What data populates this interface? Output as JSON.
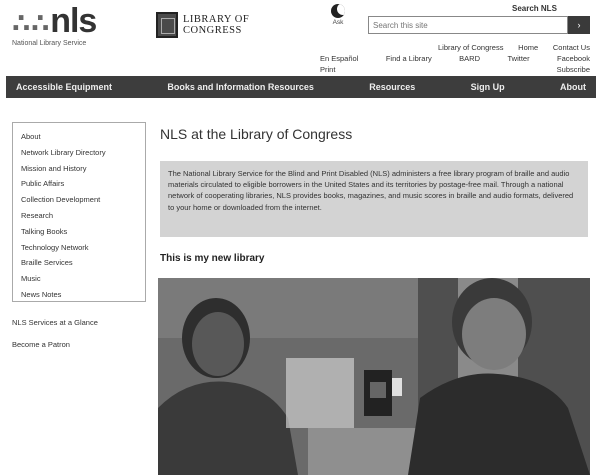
{
  "header": {
    "nls_logo": {
      "mark": "nls",
      "dots": "∴∴",
      "tagline": "National Library Service"
    },
    "loc_logo": {
      "line1": "LIBRARY OF",
      "line2": "CONGRESS"
    },
    "util_top_label": "Ask",
    "top_right_link": "Search NLS",
    "search": {
      "placeholder": "Search this site",
      "button": "›"
    },
    "small_links_row1": [
      "Library of Congress",
      "Home",
      "Contact Us"
    ],
    "small_links_row2": [
      "Find a Library",
      "BARD",
      "Twitter",
      "Facebook",
      "Subscribe"
    ],
    "left_links": [
      "En Español",
      "Print"
    ]
  },
  "nav": [
    "Accessible Equipment",
    "Books and Information Resources",
    "Resources",
    "Sign Up",
    "About"
  ],
  "sidebar": {
    "items": [
      "About",
      "Network Library Directory",
      "Mission and History",
      "Public Affairs",
      "Collection Development",
      "Research",
      "Talking Books",
      "Technology Network",
      "Braille Services",
      "Music",
      "News Notes"
    ],
    "extra_link_1": "NLS Services at a Glance",
    "extra_link_2": "Become a Patron"
  },
  "main": {
    "title": "NLS at the Library of Congress",
    "intro": "The National Library Service for the Blind and Print Disabled (NLS) administers a free library program of braille and audio materials circulated to eligible borrowers in the United States and its territories by postage-free mail. Through a national network of cooperating libraries, NLS provides books, magazines, and music scores in braille and audio formats, delivered to your home or downloaded from the internet.",
    "section_heading": "This is my new library"
  },
  "colors": {
    "nav_bg": "#3d3d3d",
    "intro_bg": "#d3d3d3",
    "sidebar_border": "#aaaaaa"
  }
}
